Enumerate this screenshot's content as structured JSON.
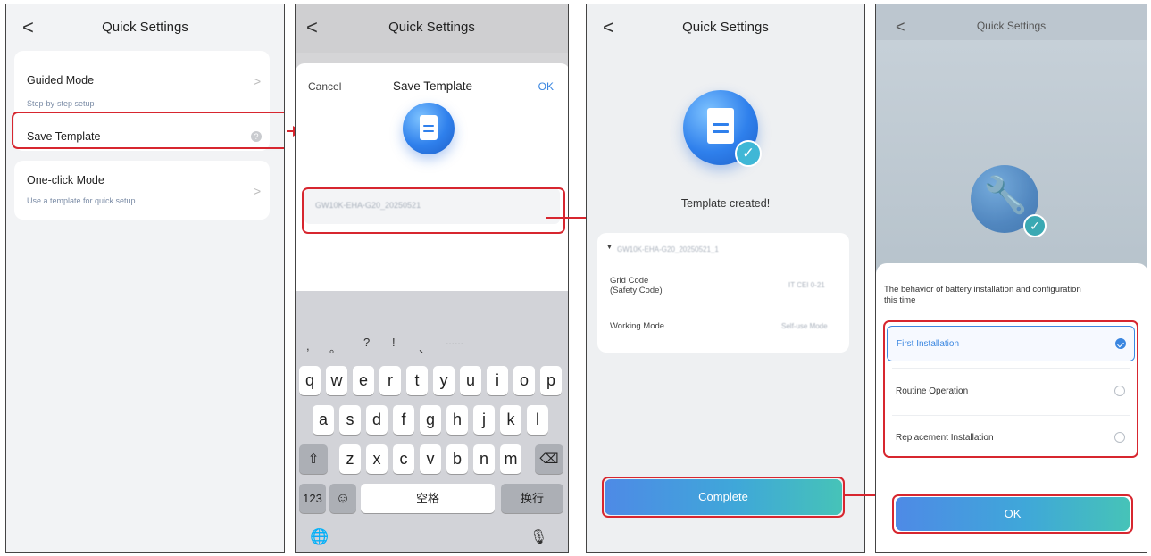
{
  "screen1": {
    "back_glyph": "<",
    "title": "Quick Settings",
    "guided_mode": {
      "label": "Guided Mode",
      "sub": "Step-by-step setup"
    },
    "save_template": {
      "label": "Save Template",
      "help": "?"
    },
    "one_click": {
      "label": "One-click Mode",
      "sub": "Use a template for quick setup"
    },
    "chevron": ">"
  },
  "screen2": {
    "back_glyph": "<",
    "title": "Quick Settings",
    "cancel": "Cancel",
    "dialog_title": "Save Template",
    "ok": "OK",
    "template_name": "GW10K-EHA-G20_20250521",
    "keyboard": {
      "symbols": [
        ",",
        "。",
        "?",
        "!",
        "、",
        "……"
      ],
      "row1": [
        "q",
        "w",
        "e",
        "r",
        "t",
        "y",
        "u",
        "i",
        "o",
        "p"
      ],
      "row2": [
        "a",
        "s",
        "d",
        "f",
        "g",
        "h",
        "j",
        "k",
        "l"
      ],
      "row3": [
        "z",
        "x",
        "c",
        "v",
        "b",
        "n",
        "m"
      ],
      "shift": "⇧",
      "delete": "⌫",
      "numbers": "123",
      "emoji": "☺",
      "space": "空格",
      "return": "换行",
      "globe": "🌐",
      "mic": "🎙"
    }
  },
  "screen3": {
    "back_glyph": "<",
    "title": "Quick Settings",
    "status": "Template created!",
    "template_name": "GW10K-EHA-G20_20250521_1",
    "grid_code_label_1": "Grid Code",
    "grid_code_label_2": "(Safety Code)",
    "grid_code_value": "IT CEI 0-21",
    "working_mode_label": "Working Mode",
    "working_mode_value": "Self-use Mode",
    "complete": "Complete"
  },
  "screen4": {
    "back_glyph": "<",
    "title": "Quick Settings",
    "question_1": "The behavior of battery installation and configuration",
    "question_2": "this time",
    "options": [
      {
        "label": "First Installation",
        "selected": true
      },
      {
        "label": "Routine Operation",
        "selected": false
      },
      {
        "label": "Replacement Installation",
        "selected": false
      }
    ],
    "ok": "OK"
  },
  "colors": {
    "highlight": "#d7262f",
    "accent_blue": "#3a86e0",
    "button_gradient_start": "#4e8ae6",
    "button_gradient_end": "#46c3b8"
  }
}
